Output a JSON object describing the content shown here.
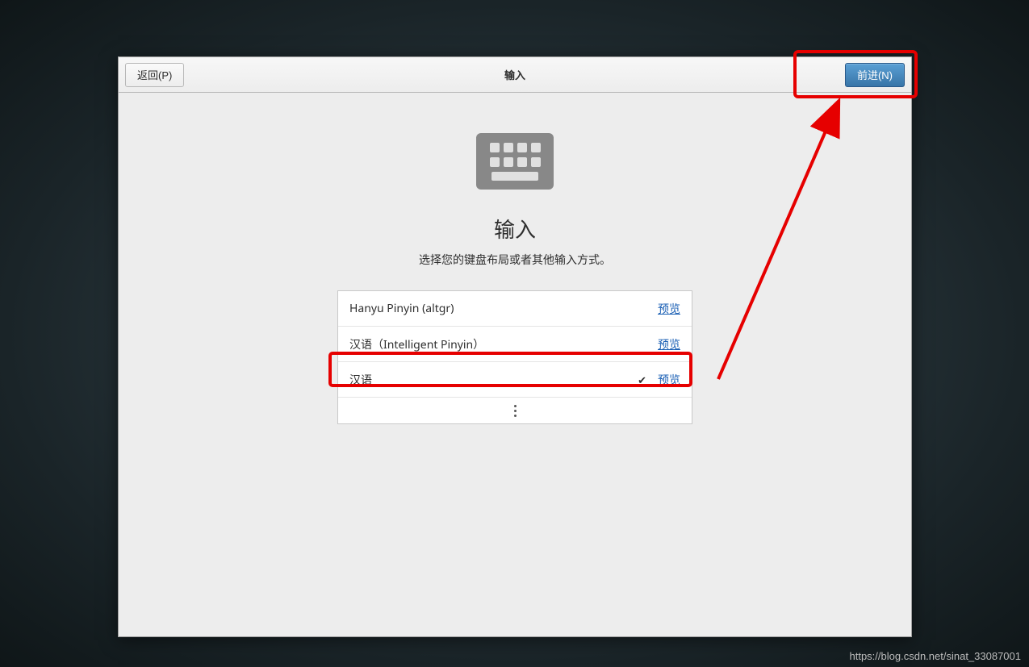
{
  "titlebar": {
    "back_label": "返回(P)",
    "title": "输入",
    "next_label": "前进(N)"
  },
  "page": {
    "heading": "输入",
    "subtitle": "选择您的键盘布局或者其他输入方式。"
  },
  "input_sources": [
    {
      "label": "Hanyu Pinyin (altgr)",
      "selected": false,
      "preview": "预览"
    },
    {
      "label": "汉语（Intelligent Pinyin）",
      "selected": false,
      "preview": "预览"
    },
    {
      "label": "汉语",
      "selected": true,
      "preview": "预览"
    }
  ],
  "watermark": "https://blog.csdn.net/sinat_33087001"
}
